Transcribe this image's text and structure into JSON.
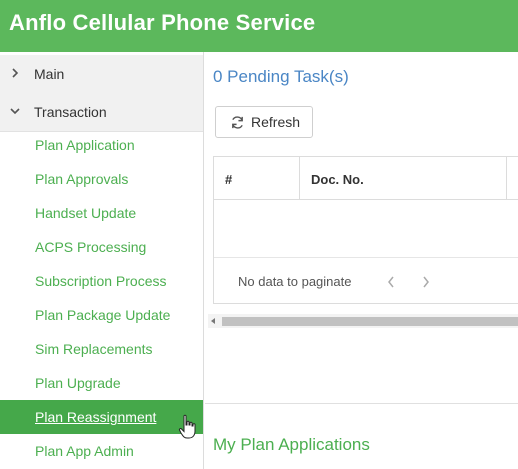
{
  "header": {
    "title": "Anflo Cellular Phone Service",
    "bg_color": "#5cb85c"
  },
  "sidebar": {
    "groups": [
      {
        "label": "Main",
        "expanded": false,
        "icon": "chevron-right-icon"
      },
      {
        "label": "Transaction",
        "expanded": true,
        "icon": "chevron-down-icon"
      }
    ],
    "items": [
      {
        "label": "Plan Application"
      },
      {
        "label": "Plan Approvals"
      },
      {
        "label": "Handset Update"
      },
      {
        "label": "ACPS Processing"
      },
      {
        "label": "Subscription Process"
      },
      {
        "label": "Plan Package Update"
      },
      {
        "label": "Sim Replacements"
      },
      {
        "label": "Plan Upgrade"
      },
      {
        "label": "Plan Reassignment",
        "active": true
      },
      {
        "label": "Plan App Admin"
      }
    ],
    "link_color": "#4caf50",
    "active_color": "#45a84a"
  },
  "main": {
    "pending_title": "0 Pending Task(s)",
    "refresh_label": "Refresh",
    "refresh_icon": "refresh-icon",
    "grid": {
      "columns": [
        "#",
        "Doc. No."
      ],
      "pager_text": "No data to paginate"
    },
    "section_title": "My Plan Applications",
    "accent_blue": "#4a86c5"
  }
}
